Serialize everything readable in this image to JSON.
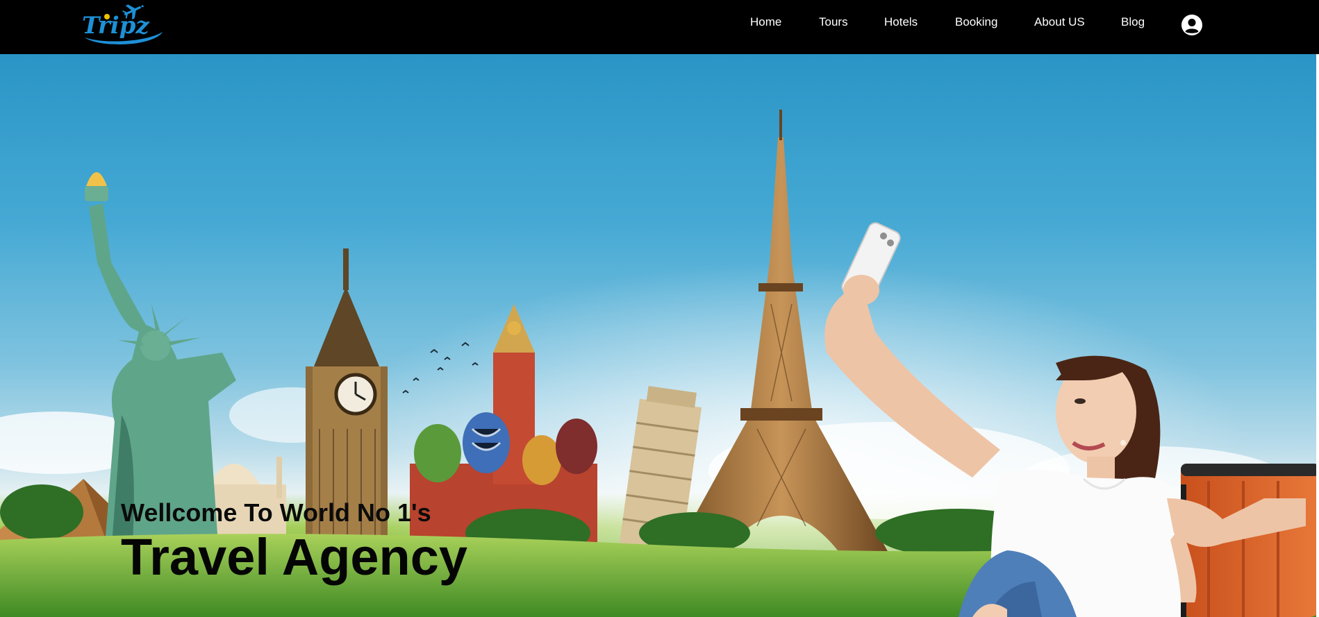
{
  "header": {
    "logo_text": "Tripz",
    "nav": [
      {
        "label": "Home"
      },
      {
        "label": "Tours"
      },
      {
        "label": "Hotels"
      },
      {
        "label": "Booking"
      },
      {
        "label": "About US"
      },
      {
        "label": "Blog"
      }
    ],
    "user_icon": "user-circle-icon"
  },
  "hero": {
    "subtitle": "Wellcome To World No 1's",
    "title": "Travel Agency",
    "image_description_icons": [
      "statue-of-liberty",
      "pyramids",
      "taj-mahal",
      "big-ben",
      "st-basils-cathedral",
      "leaning-tower-of-pisa",
      "eiffel-tower",
      "woman-taking-selfie",
      "suitcase"
    ]
  },
  "colors": {
    "header_bg": "#000000",
    "nav_text": "#ffffff",
    "logo_blue": "#1e90d6",
    "logo_yellow": "#f2c200",
    "sky": "#2a95c6",
    "grass": "#6fb03a",
    "hero_text": "#050505"
  }
}
